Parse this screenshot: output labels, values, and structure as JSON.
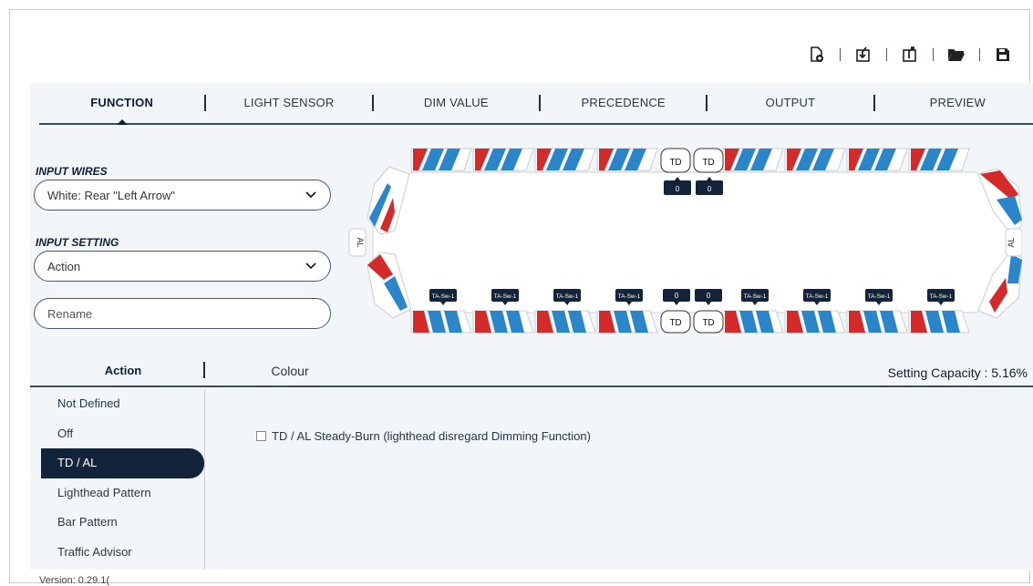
{
  "toolbar": {
    "icons": [
      "new-file-icon",
      "import-icon",
      "export-icon",
      "open-folder-icon",
      "save-icon"
    ]
  },
  "tabs": [
    {
      "label": "FUNCTION",
      "active": true
    },
    {
      "label": "LIGHT SENSOR",
      "active": false
    },
    {
      "label": "DIM VALUE",
      "active": false
    },
    {
      "label": "PRECEDENCE",
      "active": false
    },
    {
      "label": "OUTPUT",
      "active": false
    },
    {
      "label": "PREVIEW",
      "active": false
    }
  ],
  "input_wires": {
    "label": "INPUT WIRES",
    "value": "White:  Rear \"Left Arrow\""
  },
  "input_setting": {
    "label": "INPUT SETTING",
    "value": "Action"
  },
  "rename": {
    "placeholder": "Rename"
  },
  "lightbar": {
    "colors": {
      "red": "#d42a2a",
      "blue": "#2a86c8",
      "dark": "#13233a"
    },
    "top_td_labels": [
      "TD",
      "TD"
    ],
    "top_td_values": [
      "0",
      "0"
    ],
    "bottom_td_labels": [
      "TD",
      "TD"
    ],
    "bottom_td_values": [
      "0",
      "0"
    ],
    "side_left": "AL",
    "side_right": "AL",
    "tag_label": "TA-Sw-1"
  },
  "subtabs": {
    "action": "Action",
    "colour": "Colour"
  },
  "capacity": {
    "label": "Setting Capacity",
    "value": "5.16%"
  },
  "action_list": [
    {
      "label": "Not Defined",
      "active": false
    },
    {
      "label": "Off",
      "active": false
    },
    {
      "label": "TD / AL",
      "active": true
    },
    {
      "label": "Lighthead Pattern",
      "active": false
    },
    {
      "label": "Bar Pattern",
      "active": false
    },
    {
      "label": "Traffic Advisor",
      "active": false
    }
  ],
  "option": {
    "label": "TD / AL Steady-Burn (lighthead disregard Dimming Function)",
    "checked": false
  },
  "version": "Version: 0.29.1("
}
